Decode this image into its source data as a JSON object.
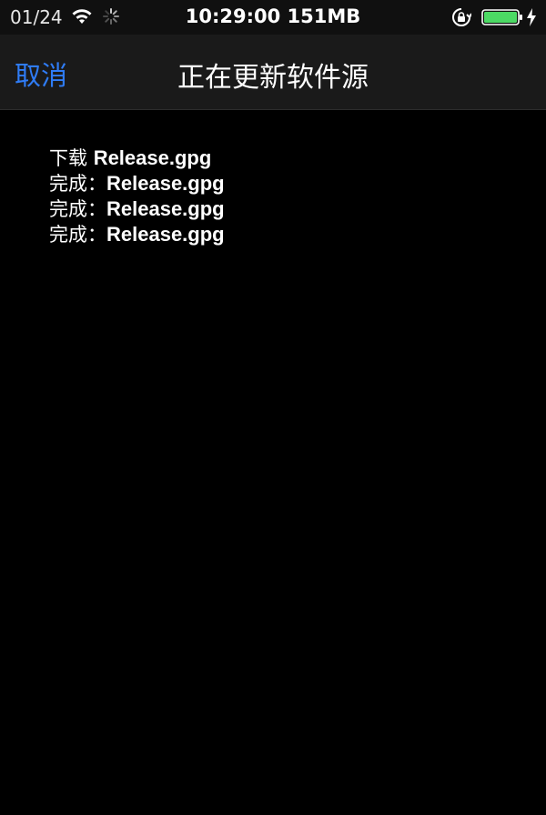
{
  "status_bar": {
    "carrier": "01/24",
    "clock": "10:29:00 151MB",
    "battery_color": "#4cd964"
  },
  "nav": {
    "cancel_label": "取消",
    "title": "正在更新软件源",
    "accent_color": "#2f7cf6"
  },
  "log": [
    {
      "prefix": "下载 ",
      "file": "Release.gpg"
    },
    {
      "prefix": "完成：",
      "file": "Release.gpg"
    },
    {
      "prefix": "完成：",
      "file": "Release.gpg"
    },
    {
      "prefix": "完成：",
      "file": "Release.gpg"
    }
  ]
}
